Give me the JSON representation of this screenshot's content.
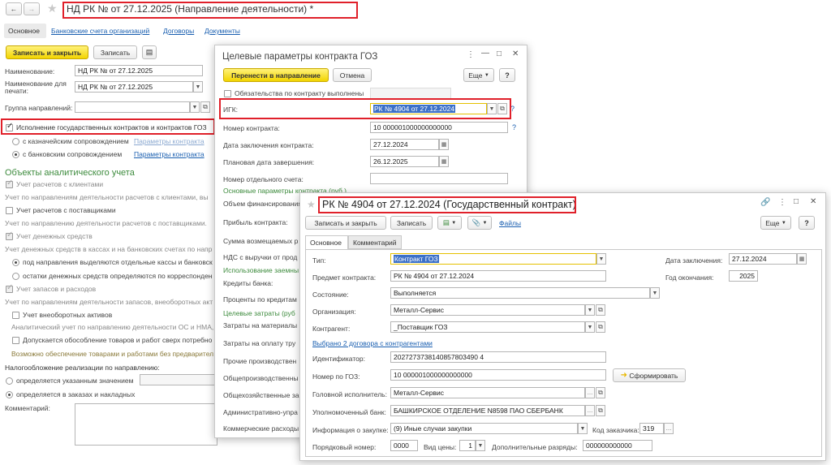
{
  "main": {
    "title": "НД РК № от 27.12.2025 (Направление деятельности) *",
    "tabs": [
      "Основное",
      "Банковские счета организаций",
      "Договоры",
      "Документы"
    ],
    "toolbar": {
      "save_close": "Записать и закрыть",
      "save": "Записать"
    },
    "fields": {
      "name_label": "Наименование:",
      "name_value": "НД РК № от 27.12.2025",
      "print_label": "Наименование для печати:",
      "print_value": "НД РК № от 27.12.2025",
      "group_label": "Группа направлений:"
    },
    "goz_checkbox": "Исполнение государственных контрактов и контрактов ГОЗ",
    "treasury_radio": "с казначейским сопровождением",
    "bank_radio": "с банковским сопровождением",
    "contract_params_link": "Параметры контракта",
    "analytics_header": "Объекты аналитического учета",
    "clients_chk": "Учет расчетов с клиентами",
    "clients_note": "Учет по направлениям деятельности расчетов с клиентами, вы",
    "suppliers_chk": "Учет расчетов с поставщиками",
    "suppliers_note": "Учет по направлению деятельности расчетов с поставщиками.",
    "cash_chk": "Учет денежных средств",
    "cash_note": "Учет денежных средств в кассах и на банковских счетах по напр",
    "cash_r1": "под направления выделяются отдельные кассы и банковск",
    "cash_r2": "остатки денежных средств определяются по корреспонден",
    "stock_chk": "Учет запасов и расходов",
    "stock_note": "Учет по направлениям деятельности запасов, внеоборотных акт",
    "fixed_chk": "Учет внеоборотных активов",
    "fixed_note": "Аналитический учет по направлению деятельности ОС и НМА,",
    "isolation_chk": "Допускается обособление товаров и работ сверх потребно",
    "isolation_note": "Возможно обеспечение товарами и работами без предварител",
    "tax_label": "Налогообложение реализации по направлению:",
    "tax_r1": "определяется указанным значением",
    "tax_r2": "определяется в заказах и накладных",
    "comment_label": "Комментарий:"
  },
  "goz": {
    "title": "Целевые параметры контракта ГОЗ",
    "transfer_btn": "Перенести в направление",
    "cancel_btn": "Отмена",
    "more_btn": "Еще",
    "help_btn": "?",
    "obligations": "Обязательства по контракту выполнены",
    "igk_label": "ИГК:",
    "igk_value": "РК № 4904 от 27.12.2024",
    "contract_num_label": "Номер контракта:",
    "contract_num_value": "10   000001000000000000",
    "date_label": "Дата заключения контракта:",
    "date_value": "27.12.2024",
    "end_label": "Плановая дата завершения:",
    "end_value": "26.12.2025",
    "account_label": "Номер отдельного счета:",
    "main_params": "Основные параметры контракта (руб.)",
    "funding": "Объем финансирования",
    "profit": "Прибыль контракта:",
    "reimb": "Сумма возмещаемых р",
    "vat": "НДС с выручки от прод",
    "usage": "Использование заемны",
    "credits": "Кредиты банка:",
    "interest": "Проценты по кредитам",
    "target_costs": "Целевые затраты (руб",
    "materials": "Затраты на материалы",
    "labor": "Затраты на оплату тру",
    "other_prod": "Прочие производствен",
    "general_prod": "Общепроизводственны",
    "general_econ": "Общехозяйственные за",
    "admin": "Административно-упра",
    "commercial": "Коммерческие расходы"
  },
  "contract": {
    "title": "РК № 4904 от 27.12.2024 (Государственный контракт)",
    "save_close": "Записать и закрыть",
    "save": "Записать",
    "files": "Файлы",
    "more_btn": "Еще",
    "help_btn": "?",
    "tabs": [
      "Основное",
      "Комментарий"
    ],
    "type_label": "Тип:",
    "type_value": "Контракт ГОЗ",
    "subject_label": "Предмет контракта:",
    "subject_value": "РК № 4904 от 27.12.2024",
    "state_label": "Состояние:",
    "state_value": "Выполняется",
    "org_label": "Организация:",
    "org_value": "Металл-Сервис",
    "counterparty_label": "Контрагент:",
    "counterparty_value": "_Поставщик ГОЗ",
    "selected_link": "Выбрано 2 договора с контрагентами",
    "ident_label": "Идентификатор:",
    "ident_value": "2027273738140857803490 4",
    "goz_num_label": "Номер по ГОЗ:",
    "goz_num_value": "10   000001000000000000",
    "generate_btn": "Сформировать",
    "head_label": "Головной исполнитель:",
    "head_value": "Металл-Сервис",
    "bank_label": "Уполномоченный банк:",
    "bank_value": "БАШКИРСКОЕ ОТДЕЛЕНИЕ N8598 ПАО СБЕРБАНК",
    "purchase_label": "Информация о закупке:",
    "purchase_value": "(9) Иные случаи закупки",
    "customer_code_label": "Код заказчика:",
    "customer_code_value": "319",
    "order_label": "Порядковый номер:",
    "order_value": "0000",
    "price_label": "Вид цены:",
    "price_value": "1",
    "extra_label": "Дополнительные разряды:",
    "extra_value": "000000000000",
    "conclusion_label": "Дата заключения:",
    "conclusion_value": "27.12.2024",
    "end_year_label": "Год окончания:",
    "end_year_value": "2025"
  }
}
